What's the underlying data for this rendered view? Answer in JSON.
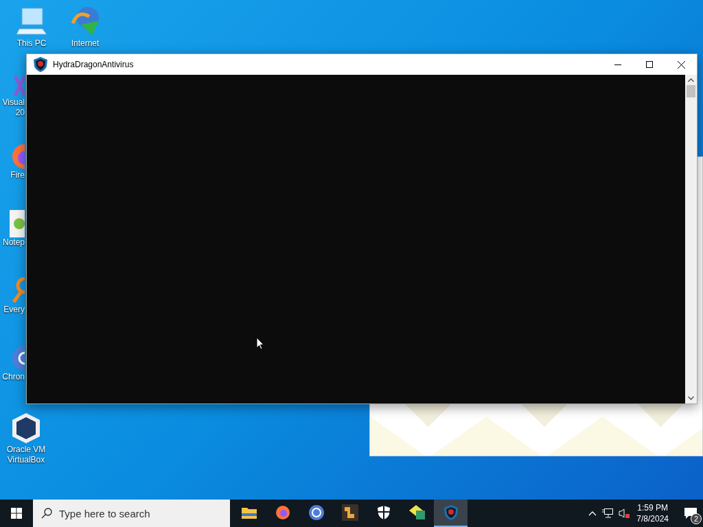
{
  "desktop_icons": [
    {
      "kind": "pc",
      "lines": [
        "This PC"
      ]
    },
    {
      "kind": "download",
      "lines": [
        "Internet"
      ]
    },
    {
      "kind": "vs",
      "lines": [
        "Visual",
        "20"
      ]
    },
    {
      "kind": "firefox",
      "lines": [
        "Fire"
      ]
    },
    {
      "kind": "notepad",
      "lines": [
        "Notep"
      ]
    },
    {
      "kind": "everything",
      "lines": [
        "Every"
      ]
    },
    {
      "kind": "chrome",
      "lines": [
        "Chron"
      ]
    },
    {
      "kind": "virtualbox",
      "lines": [
        "Oracle VM",
        "VirtualBox"
      ]
    }
  ],
  "window": {
    "title": "HydraDragonAntivirus"
  },
  "taskbar": {
    "search": {
      "placeholder": "Type here to search"
    },
    "apps": [
      {
        "kind": "explorer",
        "selected": false
      },
      {
        "kind": "firefox",
        "selected": false
      },
      {
        "kind": "chrome",
        "selected": false
      },
      {
        "kind": "app",
        "selected": false
      },
      {
        "kind": "shield",
        "selected": false
      },
      {
        "kind": "calc",
        "selected": false
      },
      {
        "kind": "hydra",
        "selected": true
      }
    ],
    "time": "1:59 PM",
    "date": "7/8/2024",
    "notifications": "2"
  }
}
